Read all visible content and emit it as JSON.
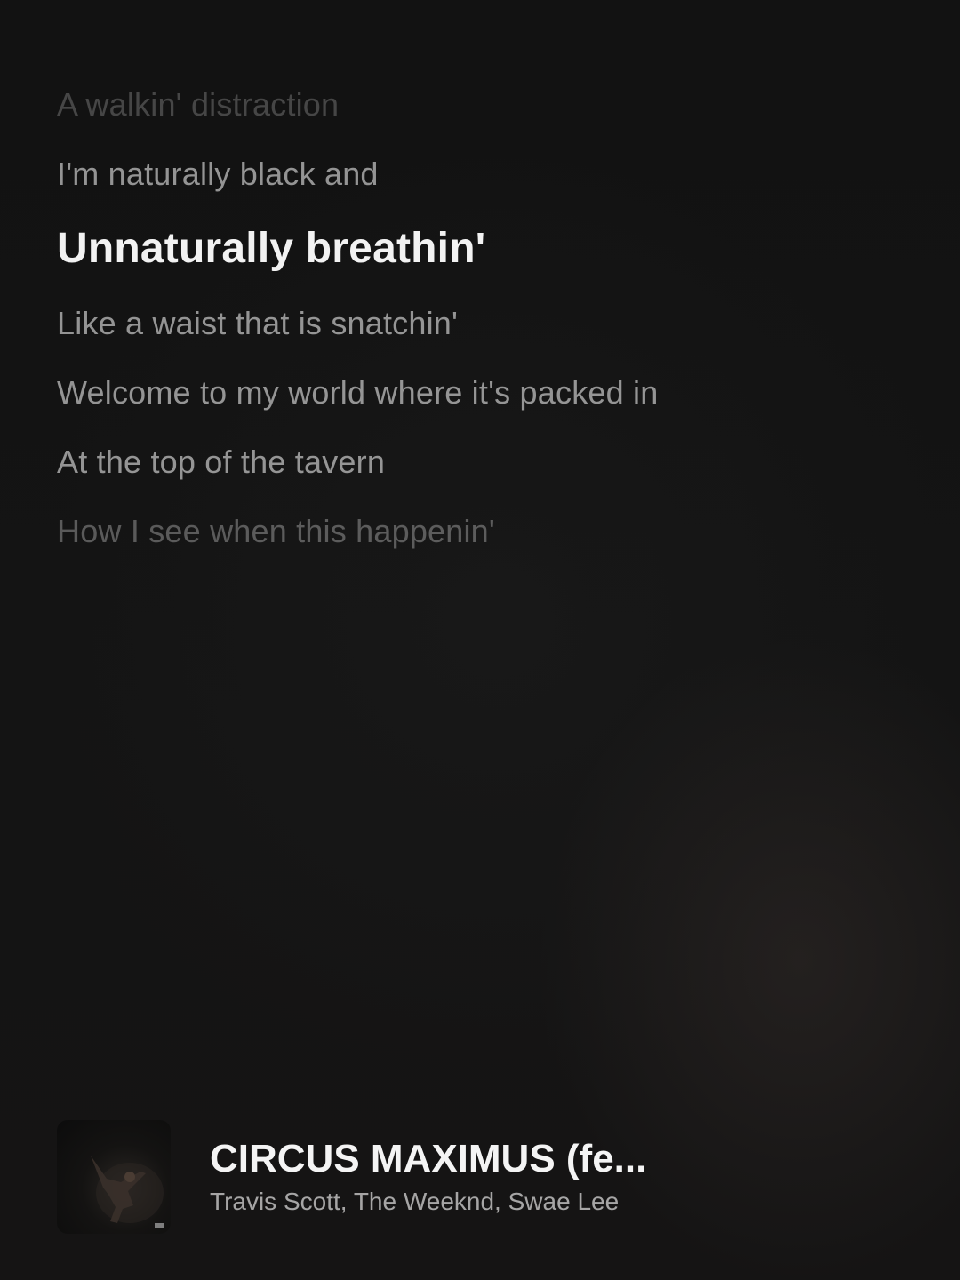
{
  "lyrics": {
    "lines": [
      "A walkin' distraction",
      "I'm naturally black and",
      "Unnaturally breathin'",
      "Like a waist that is snatchin'",
      "Welcome to my world where it's packed in",
      "At the top of the tavern",
      "How I see when this happenin'"
    ],
    "active_index": 2
  },
  "now_playing": {
    "title": "CIRCUS MAXIMUS (fe...",
    "artists": "Travis Scott, The Weeknd, Swae Lee",
    "cover_icon": "album-cover-image"
  }
}
